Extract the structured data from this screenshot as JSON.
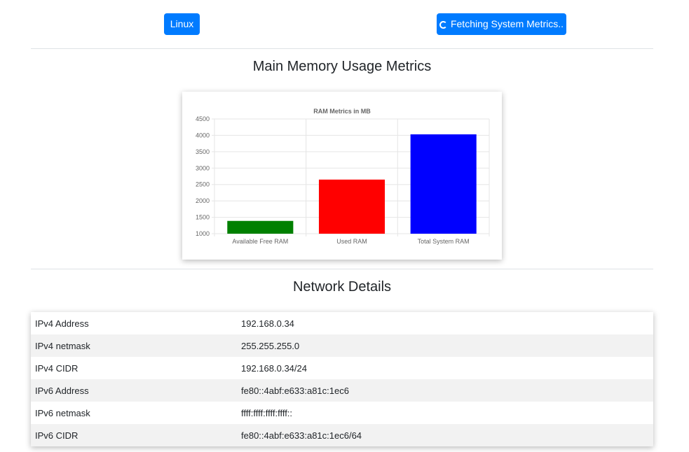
{
  "header": {
    "os_label": "Linux",
    "fetch_label": "Fetching System Metrics.."
  },
  "memory_section": {
    "title": "Main Memory Usage Metrics"
  },
  "chart_data": {
    "type": "bar",
    "title": "RAM Metrics in MB",
    "categories": [
      "Available Free RAM",
      "Used RAM",
      "Total System RAM"
    ],
    "values": [
      1390,
      2650,
      4030
    ],
    "colors": [
      "#008000",
      "#ff0000",
      "#0000ff"
    ],
    "ylim": [
      1000,
      4500
    ],
    "yticks": [
      "4500",
      "4000",
      "3500",
      "3000",
      "2500",
      "2000",
      "1500",
      "1000"
    ],
    "grid": true
  },
  "network_section": {
    "title": "Network Details",
    "rows": [
      {
        "key": "IPv4 Address",
        "value": "192.168.0.34"
      },
      {
        "key": "IPv4 netmask",
        "value": "255.255.255.0"
      },
      {
        "key": "IPv4 CIDR",
        "value": "192.168.0.34/24"
      },
      {
        "key": "IPv6 Address",
        "value": "fe80::4abf:e633:a81c:1ec6"
      },
      {
        "key": "IPv6 netmask",
        "value": "ffff:ffff:ffff:ffff::"
      },
      {
        "key": "IPv6 CIDR",
        "value": "fe80::4abf:e633:a81c:1ec6/64"
      }
    ]
  }
}
